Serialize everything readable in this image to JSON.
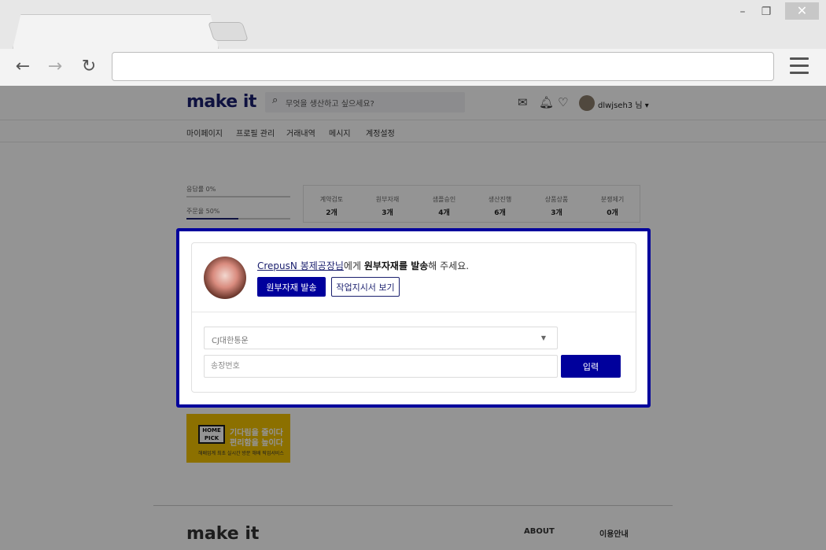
{
  "window": {
    "minimize": "–",
    "restore": "❐",
    "close": "✕"
  },
  "browser": {
    "back": "←",
    "forward": "→",
    "reload": "↻",
    "address": ""
  },
  "site": {
    "logo": "make it",
    "search_placeholder": "무엇을 생산하고 싶으세요?",
    "user_name": "dlwjseh3 님 ▾",
    "nav": [
      "마이페이지",
      "프로필 관리",
      "거래내역",
      "메시지",
      "계정설정"
    ]
  },
  "progress": [
    {
      "label": "응답률 0%",
      "value": 0
    },
    {
      "label": "주문율 50%",
      "value": 50
    }
  ],
  "stats": [
    {
      "label": "계약검토",
      "value": "2개"
    },
    {
      "label": "원부자재",
      "value": "3개"
    },
    {
      "label": "샘플승인",
      "value": "4개"
    },
    {
      "label": "생산진행",
      "value": "6개"
    },
    {
      "label": "상품상품",
      "value": "3개"
    },
    {
      "label": "분쟁제기",
      "value": "0개"
    }
  ],
  "banner": {
    "badge": "HOME PICK",
    "line1": "기다림을 줄이다",
    "line2": "편리함을 높이다",
    "sub": "해배업계 최초 실시간 방문 해배 픽업서비스"
  },
  "footer": {
    "logo": "make it",
    "col1": "ABOUT",
    "col2": "이용안내"
  },
  "modal": {
    "factory": "CrepusN 봉제공장님",
    "msg_mid": "에게 ",
    "msg_bold": "원부자재를 발송",
    "msg_end": "해 주세요.",
    "send_button": "원부자재 발송",
    "view_button": "작업지시서 보기",
    "courier_selected": "CJ대한통운",
    "tracking_placeholder": "송장번호",
    "submit_button": "입력"
  },
  "colors": {
    "accent": "#00009c",
    "brand": "#1a1f6e",
    "banner": "#f2c200"
  }
}
